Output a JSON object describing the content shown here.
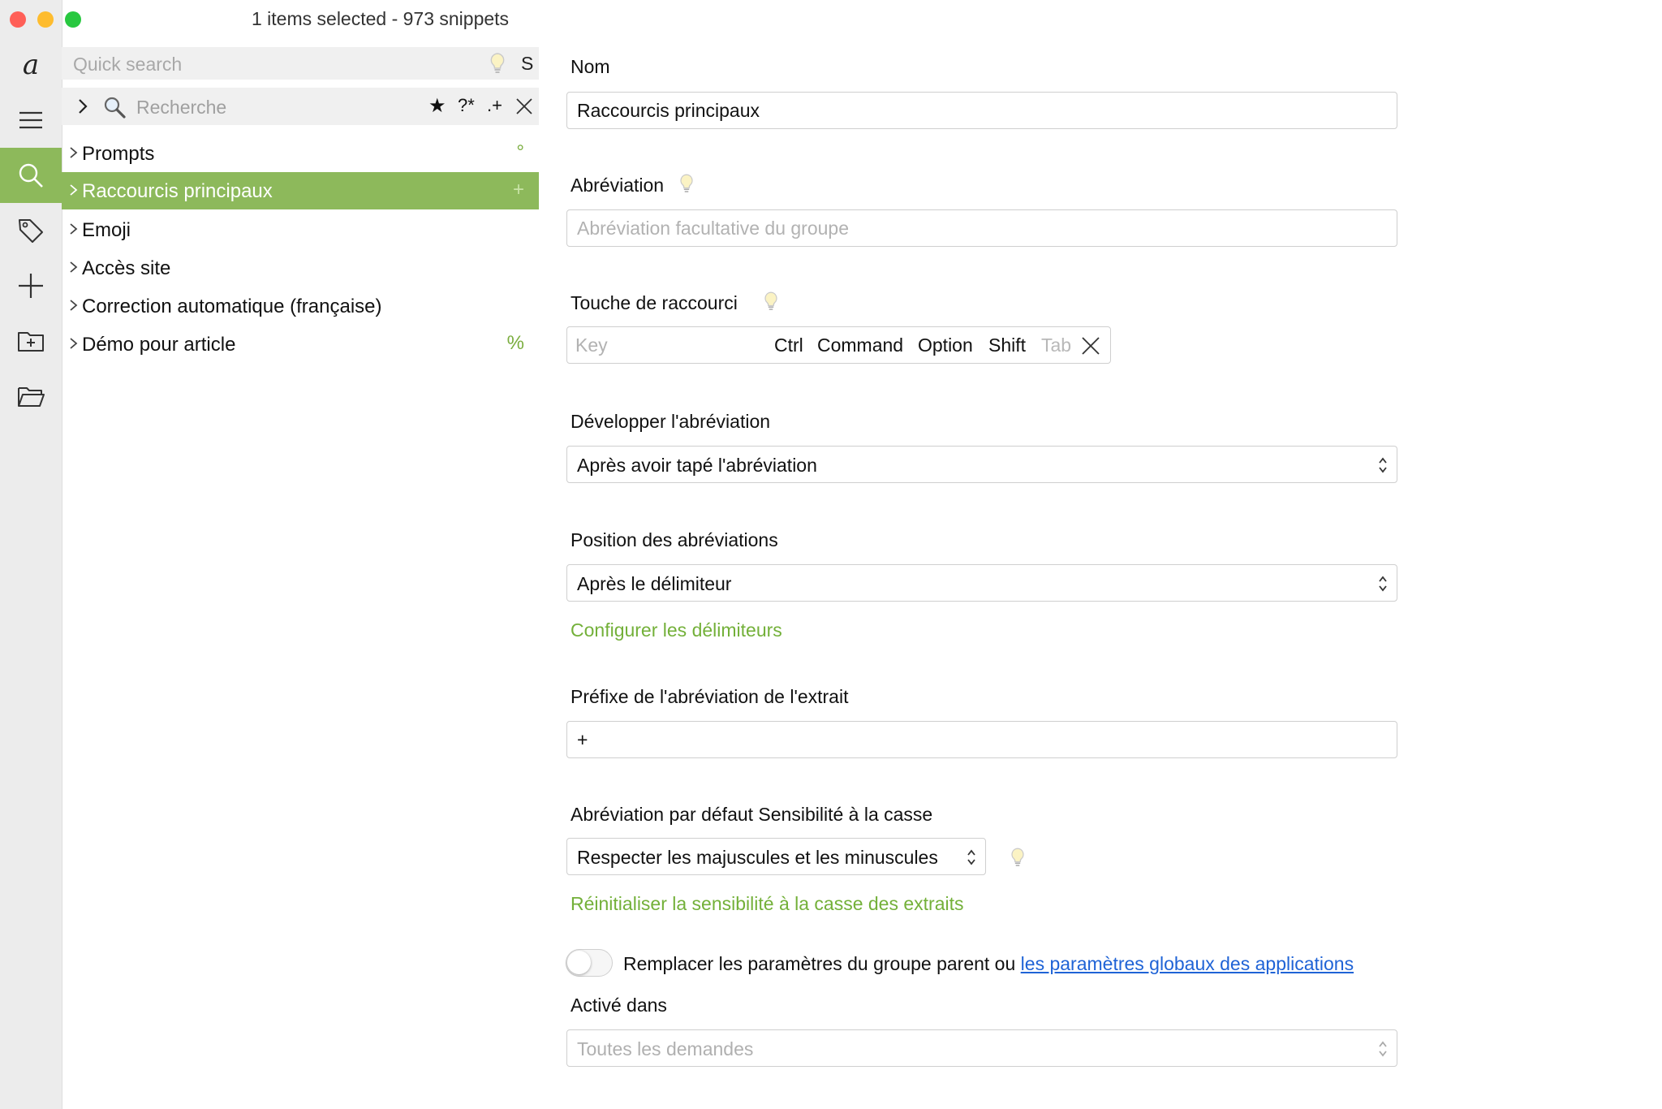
{
  "window": {
    "title": "1 items selected - 973 snippets"
  },
  "rail": {
    "logo": "a"
  },
  "quick_search": {
    "placeholder": "Quick search",
    "shortcut": "S"
  },
  "search": {
    "placeholder": "Recherche",
    "favorites_glyph": "★",
    "wildcard_label": "?*",
    "regex_label": ".+"
  },
  "groups": [
    {
      "label": "Prompts",
      "badge": "°",
      "selected": false
    },
    {
      "label": "Raccourcis principaux",
      "badge": "+",
      "selected": true
    },
    {
      "label": "Emoji",
      "badge": "",
      "selected": false
    },
    {
      "label": "Accès site",
      "badge": "",
      "selected": false
    },
    {
      "label": "Correction automatique (française)",
      "badge": "",
      "selected": false
    },
    {
      "label": "Démo pour article",
      "badge": "%",
      "selected": false
    }
  ],
  "form": {
    "name_label": "Nom",
    "name_value": "Raccourcis principaux",
    "abbr_label": "Abréviation",
    "abbr_placeholder": "Abréviation facultative du groupe",
    "hotkey_label": "Touche de raccourci",
    "hotkey": {
      "key_placeholder": "Key",
      "modifiers": [
        "Ctrl",
        "Command",
        "Option",
        "Shift",
        "Tab"
      ]
    },
    "expand_label": "Développer l'abréviation",
    "expand_value": "Après avoir tapé l'abréviation",
    "position_label": "Position des abréviations",
    "position_value": "Après le délimiteur",
    "configure_delimiters_link": "Configurer les délimiteurs",
    "prefix_label": "Préfixe de l'abréviation de l'extrait",
    "prefix_value": "+",
    "case_label": "Abréviation par défaut Sensibilité à la casse",
    "case_value": "Respecter les majuscules et les minuscules",
    "reset_case_link": "Réinitialiser la sensibilité à la casse des extraits",
    "replace_text": "Remplacer les paramètres du groupe parent ou ",
    "replace_link": "les paramètres globaux des applications",
    "replace_enabled": false,
    "enabled_in_label": "Activé dans",
    "enabled_in_value": "Toutes les demandes"
  },
  "colors": {
    "accent_green": "#8db95b",
    "link_green": "#73b039",
    "link_blue": "#1f63d6"
  },
  "icons": [
    "logo-icon",
    "menu-icon",
    "search-icon",
    "tag-icon",
    "plus-icon",
    "new-folder-icon",
    "open-folder-icon",
    "lightbulb-icon",
    "magnifier-icon",
    "close-icon",
    "chevron-right-icon",
    "updown-arrows-icon"
  ]
}
